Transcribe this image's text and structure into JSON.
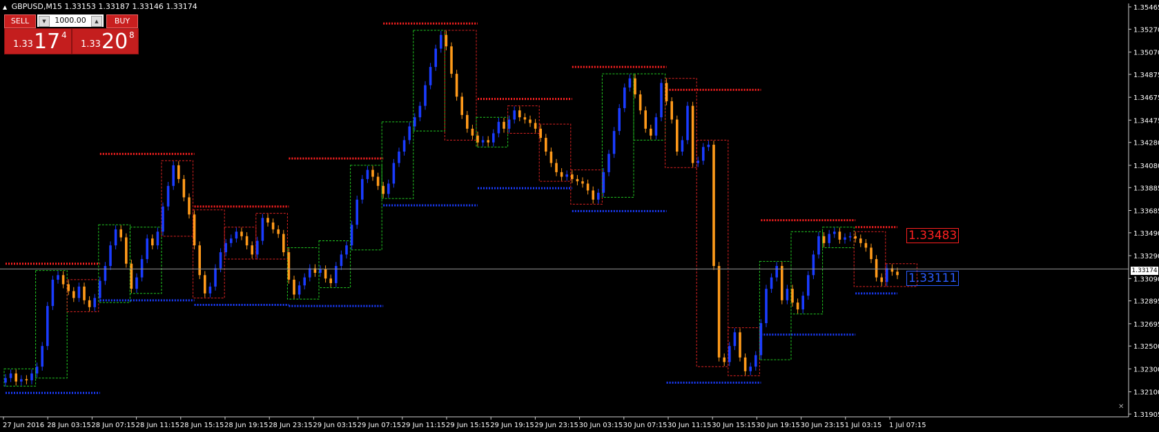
{
  "header": {
    "symbol": "GBPUSD,M15",
    "ohlc": "1.33153 1.33187 1.33146 1.33174"
  },
  "trade_panel": {
    "sell_label": "SELL",
    "buy_label": "BUY",
    "lot": "1000.00",
    "sell_prefix": "1.33",
    "sell_big": "17",
    "sell_sup": "4",
    "buy_prefix": "1.33",
    "buy_big": "20",
    "buy_sup": "8"
  },
  "price_tag": "1.33174",
  "labels": {
    "high_level": "1.33483",
    "low_level": "1.33111"
  },
  "colors": {
    "background": "#000000",
    "bull_candle": "#1a3cff",
    "bear_candle": "#ff9a1a",
    "resistance": "#ff2020",
    "support": "#1a3cff",
    "box_up": "#22cc22",
    "box_down": "#dd2222"
  },
  "chart_data": {
    "type": "line",
    "ylim": [
      1.31905,
      1.35465
    ],
    "y_ticks": [
      "1.35465",
      "1.35270",
      "1.35070",
      "1.34875",
      "1.34675",
      "1.34475",
      "1.34280",
      "1.34080",
      "1.33885",
      "1.33685",
      "1.33490",
      "1.33290",
      "1.33090",
      "1.32895",
      "1.32695",
      "1.32500",
      "1.32300",
      "1.32100",
      "1.31905"
    ],
    "x_tick_labels": [
      "27 Jun 2016",
      "28 Jun 03:15",
      "28 Jun 07:15",
      "28 Jun 11:15",
      "28 Jun 15:15",
      "28 Jun 19:15",
      "28 Jun 23:15",
      "29 Jun 03:15",
      "29 Jun 07:15",
      "29 Jun 11:15",
      "29 Jun 15:15",
      "29 Jun 19:15",
      "29 Jun 23:15",
      "30 Jun 03:15",
      "30 Jun 07:15",
      "30 Jun 11:15",
      "30 Jun 15:15",
      "30 Jun 19:15",
      "30 Jun 23:15",
      "1 Jul 03:15",
      "1 Jul 07:15"
    ],
    "current_price": 1.33174,
    "series": [
      {
        "name": "",
        "values": [
          1.3222,
          1.3226,
          1.3219,
          1.3221,
          1.322,
          1.3226,
          1.3232,
          1.325,
          1.3285,
          1.3308,
          1.3312,
          1.3304,
          1.3298,
          1.3292,
          1.3302,
          1.329,
          1.3284,
          1.3292,
          1.3307,
          1.332,
          1.3338,
          1.3352,
          1.3345,
          1.3322,
          1.33,
          1.331,
          1.3326,
          1.3344,
          1.3338,
          1.335,
          1.3372,
          1.339,
          1.3408,
          1.3396,
          1.338,
          1.3365,
          1.3338,
          1.3312,
          1.3296,
          1.3302,
          1.3318,
          1.3332,
          1.334,
          1.3344,
          1.335,
          1.3346,
          1.3338,
          1.333,
          1.3342,
          1.3362,
          1.3358,
          1.3352,
          1.3348,
          1.3332,
          1.3308,
          1.3295,
          1.3303,
          1.331,
          1.3318,
          1.3314,
          1.3317,
          1.3309,
          1.3305,
          1.332,
          1.333,
          1.3338,
          1.3356,
          1.3378,
          1.3396,
          1.3404,
          1.3398,
          1.339,
          1.3383,
          1.3392,
          1.341,
          1.342,
          1.343,
          1.3442,
          1.345,
          1.346,
          1.3478,
          1.3494,
          1.351,
          1.3522,
          1.3512,
          1.3488,
          1.3468,
          1.3452,
          1.344,
          1.3434,
          1.3428,
          1.343,
          1.3428,
          1.3436,
          1.3446,
          1.344,
          1.3448,
          1.3456,
          1.345,
          1.3448,
          1.3445,
          1.344,
          1.3432,
          1.342,
          1.341,
          1.3402,
          1.3398,
          1.34,
          1.3396,
          1.3394,
          1.3392,
          1.3386,
          1.3378,
          1.3384,
          1.3402,
          1.3418,
          1.3438,
          1.3458,
          1.3476,
          1.3484,
          1.347,
          1.3456,
          1.344,
          1.3434,
          1.345,
          1.348,
          1.3464,
          1.3448,
          1.342,
          1.343,
          1.346,
          1.341,
          1.3412,
          1.3424,
          1.3426,
          1.332,
          1.324,
          1.3236,
          1.325,
          1.3262,
          1.324,
          1.3228,
          1.3232,
          1.3242,
          1.327,
          1.33,
          1.331,
          1.332,
          1.329,
          1.33,
          1.3288,
          1.3282,
          1.3294,
          1.3312,
          1.333,
          1.3346,
          1.334,
          1.3348,
          1.335,
          1.3343,
          1.3345,
          1.3346,
          1.3344,
          1.334,
          1.3336,
          1.3326,
          1.331,
          1.3306,
          1.3318,
          1.3315,
          1.3312
        ]
      }
    ]
  }
}
